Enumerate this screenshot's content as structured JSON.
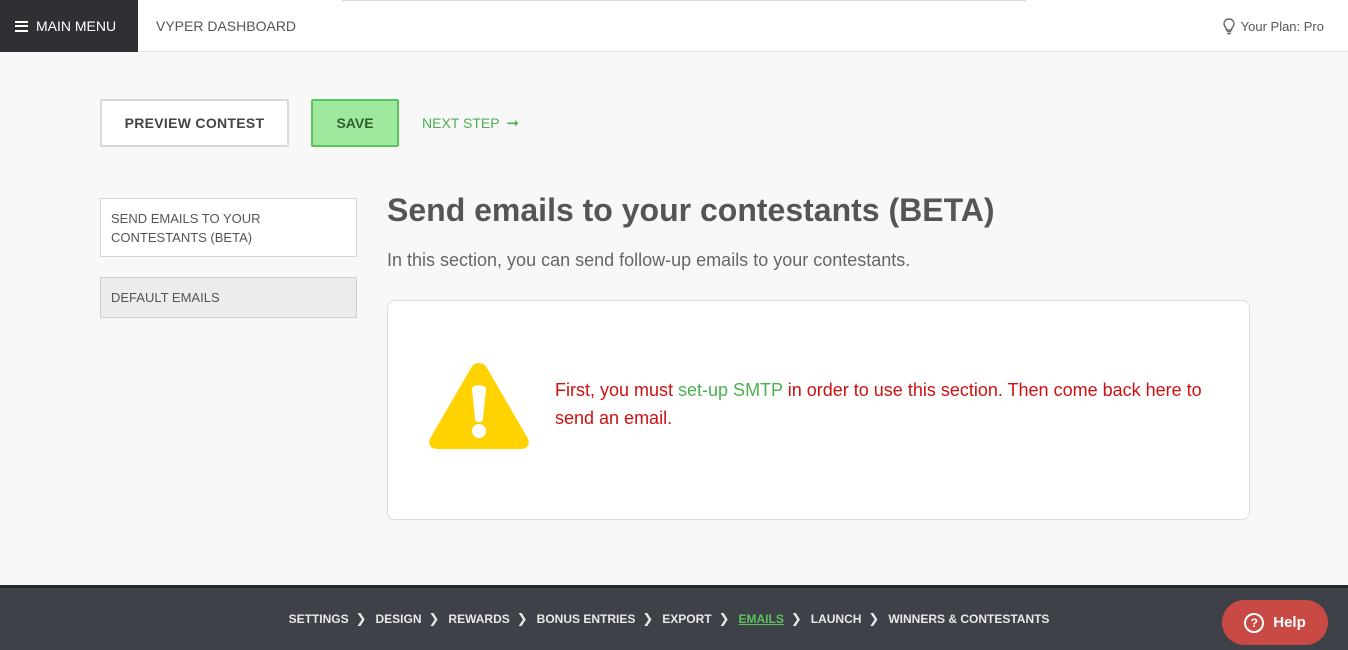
{
  "header": {
    "menu_label": "MAIN MENU",
    "dashboard_title": "VYPER DASHBOARD",
    "plan_label": "Your Plan: Pro"
  },
  "actions": {
    "preview_label": "PREVIEW CONTEST",
    "save_label": "SAVE",
    "next_label": "NEXT STEP",
    "next_arrow": "➞"
  },
  "sidebar": {
    "items": [
      {
        "label": "SEND EMAILS TO YOUR CONTESTANTS (BETA)"
      },
      {
        "label": "DEFAULT EMAILS"
      }
    ]
  },
  "main": {
    "title": "Send emails to your contestants (BETA)",
    "subtitle": "In this section, you can send follow-up emails to your contestants.",
    "notice": {
      "text_before": "First, you must ",
      "link": "set-up SMTP",
      "text_after": " in order to use this section. Then come back here to send an email."
    }
  },
  "footer": {
    "steps": [
      {
        "label": "SETTINGS"
      },
      {
        "label": "DESIGN"
      },
      {
        "label": "REWARDS"
      },
      {
        "label": "BONUS ENTRIES"
      },
      {
        "label": "EXPORT"
      },
      {
        "label": "EMAILS",
        "active": true
      },
      {
        "label": "LAUNCH"
      },
      {
        "label": "WINNERS & CONTESTANTS"
      }
    ],
    "separator": "❯",
    "help_label": "Help",
    "help_icon": "?"
  },
  "colors": {
    "accent_green": "#4caf50",
    "save_bg": "#9ee99e",
    "warning_red": "#cc1111",
    "warning_yellow": "#ffd200",
    "help_red": "#c94a45",
    "footer_bg": "#3e4147"
  },
  "icons": {
    "menu": "hamburger-icon",
    "plan": "lightbulb-icon",
    "notice": "warning-icon",
    "help": "question-icon"
  }
}
